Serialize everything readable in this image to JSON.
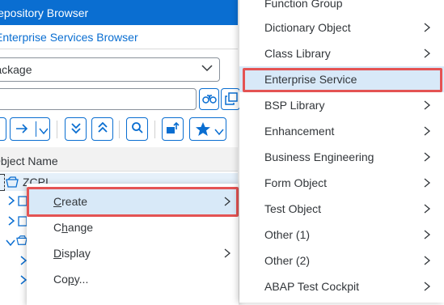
{
  "window": {
    "title": "Repository Browser"
  },
  "tabs": {
    "active": "Enterprise Services Browser"
  },
  "filter": {
    "selected_value": "Package",
    "search_value": ""
  },
  "tree": {
    "column_header": "Object Name",
    "root_label": "ZCPI"
  },
  "context_menu": {
    "items": [
      {
        "label": "Create",
        "underline": "C",
        "rest": "reate",
        "has_submenu": true
      },
      {
        "label": "Change",
        "underline": "h",
        "pre": "C",
        "rest": "ange",
        "has_submenu": false
      },
      {
        "label": "Display",
        "underline": "D",
        "rest": "isplay",
        "has_submenu": true
      },
      {
        "label": "Copy...",
        "underline": "p",
        "pre": "Co",
        "rest": "y...",
        "has_submenu": false
      }
    ]
  },
  "create_submenu": {
    "items": [
      {
        "label": "Function Group",
        "has_submenu": false
      },
      {
        "label": "Dictionary Object",
        "has_submenu": true
      },
      {
        "label": "Class Library",
        "has_submenu": true
      },
      {
        "label": "Enterprise Service",
        "has_submenu": false
      },
      {
        "label": "BSP Library",
        "has_submenu": true
      },
      {
        "label": "Enhancement",
        "has_submenu": true
      },
      {
        "label": "Business Engineering",
        "has_submenu": true
      },
      {
        "label": "Form Object",
        "has_submenu": true
      },
      {
        "label": "Test Object",
        "has_submenu": true
      },
      {
        "label": "Other (1)",
        "has_submenu": true
      },
      {
        "label": "Other (2)",
        "has_submenu": true
      },
      {
        "label": "ABAP Test Cockpit",
        "has_submenu": true
      }
    ]
  },
  "colors": {
    "accent": "#0a6ed1",
    "highlight_border": "#e45353",
    "selected_bg": "#d8e9f8"
  }
}
